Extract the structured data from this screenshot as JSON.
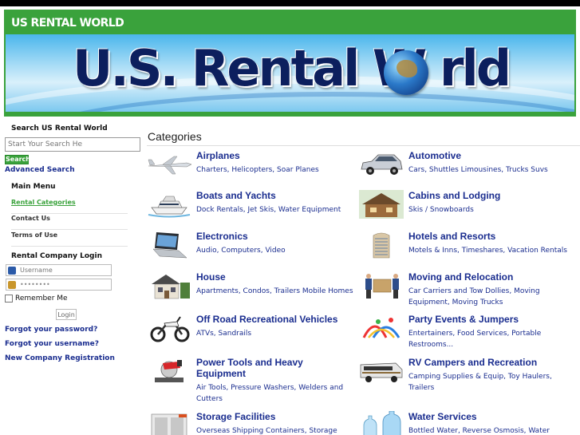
{
  "header": {
    "title": "US RENTAL WORLD",
    "logo_text": "U.S. Rental W rld"
  },
  "sidebar": {
    "search_title": "Search US Rental World",
    "search_placeholder": "Start Your Search He",
    "search_button": "Search",
    "advanced_search": "Advanced Search",
    "menu_title": "Main Menu",
    "menu_items": [
      {
        "label": "Rental Categories",
        "active": true
      },
      {
        "label": "Contact Us",
        "active": false
      },
      {
        "label": "Terms of Use",
        "active": false
      }
    ],
    "login_title": "Rental Company Login",
    "username_placeholder": "Username",
    "password_value": "••••••••",
    "remember_label": "Remember Me",
    "login_button": "Login",
    "links": [
      "Forgot your password?",
      "Forgot your username?",
      "New Company Registration"
    ]
  },
  "main": {
    "heading": "Categories",
    "categories": [
      {
        "title": "Airplanes",
        "sub": "Charters, Helicopters, Soar Planes",
        "icon": "airplane-icon"
      },
      {
        "title": "Automotive",
        "sub": "Cars, Shuttles Limousines, Trucks Suvs",
        "icon": "car-icon"
      },
      {
        "title": "Boats and Yachts",
        "sub": "Dock Rentals, Jet Skis, Water Equipment",
        "icon": "yacht-icon"
      },
      {
        "title": "Cabins and Lodging",
        "sub": "Skis / Snowboards",
        "icon": "cabin-icon"
      },
      {
        "title": "Electronics",
        "sub": "Audio, Computers, Video",
        "icon": "laptop-icon"
      },
      {
        "title": "Hotels and Resorts",
        "sub": "Motels & Inns, Timeshares, Vacation Rentals",
        "icon": "hotel-icon"
      },
      {
        "title": "House",
        "sub": "Apartments, Condos, Trailers Mobile Homes",
        "icon": "house-icon"
      },
      {
        "title": "Moving and Relocation",
        "sub": "Car Carriers and Tow Dollies, Moving Equipment, Moving Trucks",
        "icon": "movers-icon"
      },
      {
        "title": "Off Road Recreational Vehicles",
        "sub": "ATVs, Sandrails",
        "icon": "dirtbike-icon"
      },
      {
        "title": "Party Events & Jumpers",
        "sub": "Entertainers, Food Services, Portable Restrooms...",
        "icon": "party-icon"
      },
      {
        "title": "Power Tools and Heavy Equipment",
        "sub": "Air Tools, Pressure Washers, Welders and Cutters",
        "icon": "saw-icon"
      },
      {
        "title": "RV Campers and Recreation",
        "sub": "Camping Supplies & Equip, Toy Haulers, Trailers",
        "icon": "rv-icon"
      },
      {
        "title": "Storage Facilities",
        "sub": "Overseas Shipping Containers, Storage Pods,",
        "icon": "storage-icon"
      },
      {
        "title": "Water Services",
        "sub": "Bottled Water, Reverse Osmosis, Water",
        "icon": "water-bottle-icon"
      }
    ]
  }
}
